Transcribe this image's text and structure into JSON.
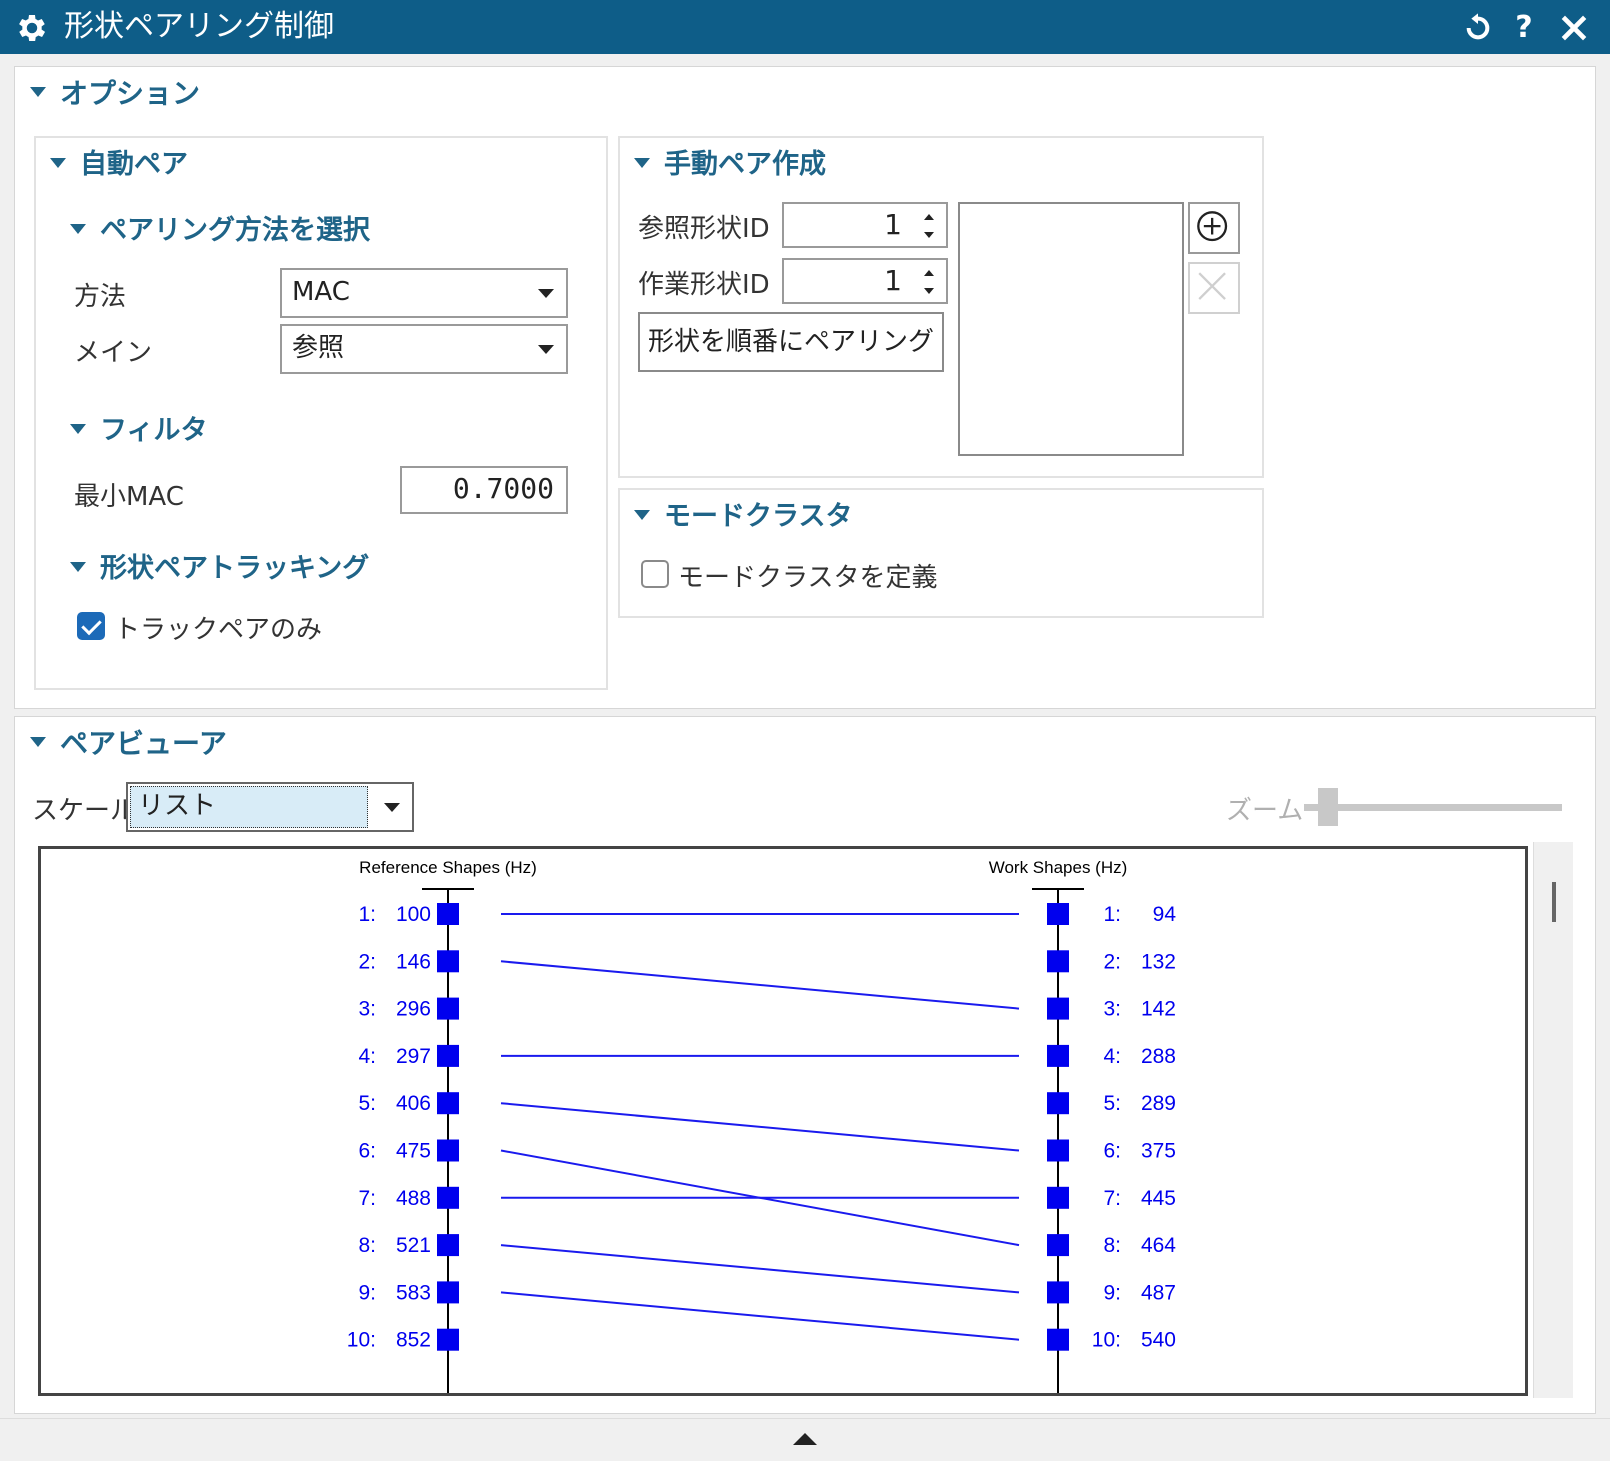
{
  "window": {
    "title": "形状ペアリング制御"
  },
  "options": {
    "header": "オプション",
    "auto_pair": {
      "header": "自動ペア",
      "method_section": {
        "header": "ペアリング方法を選択",
        "method_label": "方法",
        "method_value": "MAC",
        "main_label": "メイン",
        "main_value": "参照"
      },
      "filter_section": {
        "header": "フィルタ",
        "min_mac_label": "最小MAC",
        "min_mac_value": "0.7000"
      },
      "tracking_section": {
        "header": "形状ペアトラッキング",
        "track_pairs_only_label": "トラックペアのみ",
        "track_pairs_only_checked": true
      }
    },
    "manual_pair": {
      "header": "手動ペア作成",
      "ref_id_label": "参照形状ID",
      "ref_id_value": "1",
      "work_id_label": "作業形状ID",
      "work_id_value": "1",
      "pair_sequential_label": "形状を順番にペアリング"
    },
    "mode_cluster": {
      "header": "モードクラスタ",
      "define_label": "モードクラスタを定義",
      "define_checked": false
    }
  },
  "pair_viewer": {
    "header": "ペアビューア",
    "scale_label": "スケール",
    "scale_value": "リスト",
    "zoom_label": "ズーム",
    "ref_title": "Reference Shapes (Hz)",
    "work_title": "Work Shapes (Hz)",
    "reference_shapes": [
      {
        "id": "1:",
        "freq": "100"
      },
      {
        "id": "2:",
        "freq": "146"
      },
      {
        "id": "3:",
        "freq": "296"
      },
      {
        "id": "4:",
        "freq": "297"
      },
      {
        "id": "5:",
        "freq": "406"
      },
      {
        "id": "6:",
        "freq": "475"
      },
      {
        "id": "7:",
        "freq": "488"
      },
      {
        "id": "8:",
        "freq": "521"
      },
      {
        "id": "9:",
        "freq": "583"
      },
      {
        "id": "10:",
        "freq": "852"
      }
    ],
    "work_shapes": [
      {
        "id": "1:",
        "freq": "94"
      },
      {
        "id": "2:",
        "freq": "132"
      },
      {
        "id": "3:",
        "freq": "142"
      },
      {
        "id": "4:",
        "freq": "288"
      },
      {
        "id": "5:",
        "freq": "289"
      },
      {
        "id": "6:",
        "freq": "375"
      },
      {
        "id": "7:",
        "freq": "445"
      },
      {
        "id": "8:",
        "freq": "464"
      },
      {
        "id": "9:",
        "freq": "487"
      },
      {
        "id": "10:",
        "freq": "540"
      }
    ],
    "pairs": [
      [
        1,
        1
      ],
      [
        2,
        3
      ],
      [
        4,
        4
      ],
      [
        5,
        6
      ],
      [
        6,
        8
      ],
      [
        7,
        7
      ],
      [
        8,
        9
      ],
      [
        9,
        10
      ]
    ],
    "marker_color": "#0000ee",
    "line_color": "#1a1aee"
  },
  "colors": {
    "titlebar": "#0e5d88",
    "header_text": "#1f6488",
    "checkbox": "#1c6ab8"
  }
}
